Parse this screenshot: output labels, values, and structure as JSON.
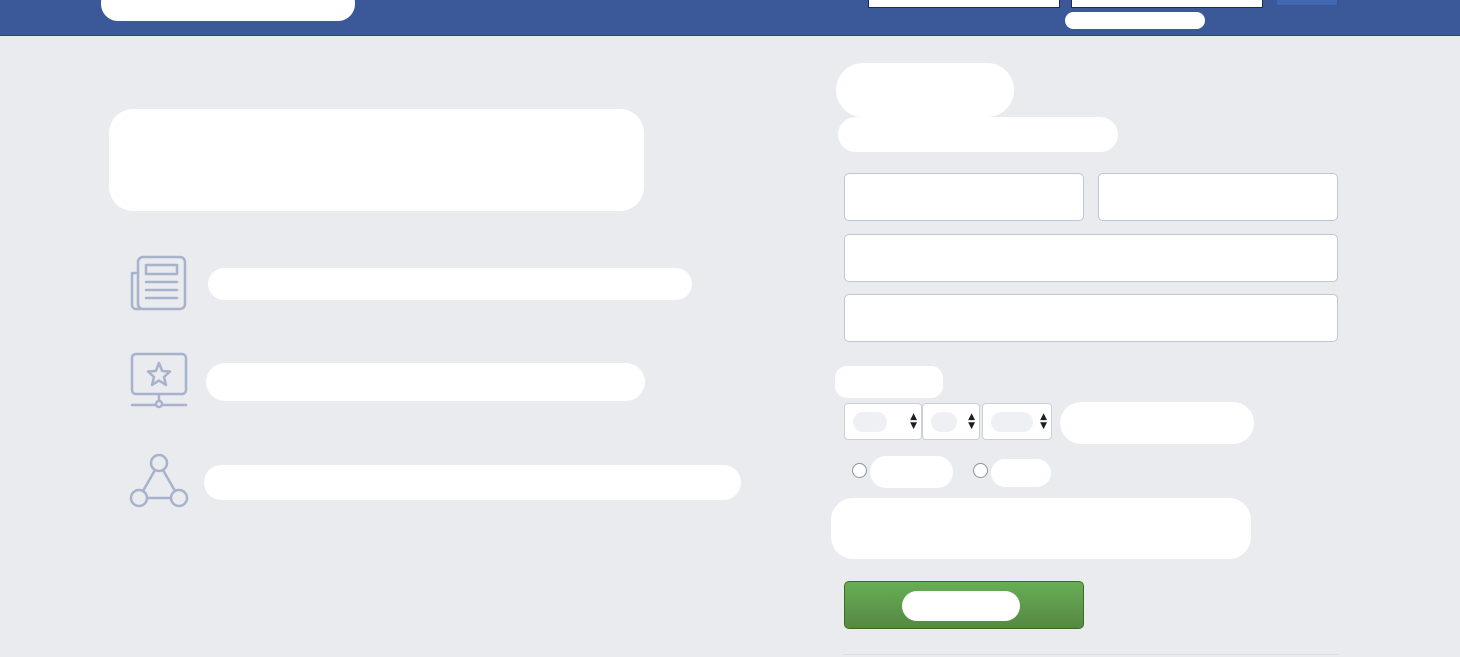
{
  "header": {
    "logo_text": "",
    "email_placeholder": "",
    "password_placeholder": "",
    "login_label": "",
    "forgot_label": ""
  },
  "left": {
    "headline": "",
    "features": [
      {
        "icon": "news-feed-icon",
        "label": ""
      },
      {
        "icon": "monitor-star-icon",
        "label": ""
      },
      {
        "icon": "share-nodes-icon",
        "label": ""
      }
    ]
  },
  "signup": {
    "title": "",
    "subtitle": "",
    "first_name_placeholder": "",
    "last_name_placeholder": "",
    "contact_placeholder": "",
    "password_placeholder": "",
    "birthday_label": "",
    "day_value": "",
    "month_value": "",
    "year_value": "",
    "birthday_help": "",
    "gender_female": "",
    "gender_male": "",
    "terms": "",
    "submit_label": ""
  },
  "colors": {
    "topbar": "#3b5998",
    "background": "#e9ebee",
    "signup_button": "#5aa040",
    "icon": "#a8b2cc"
  }
}
